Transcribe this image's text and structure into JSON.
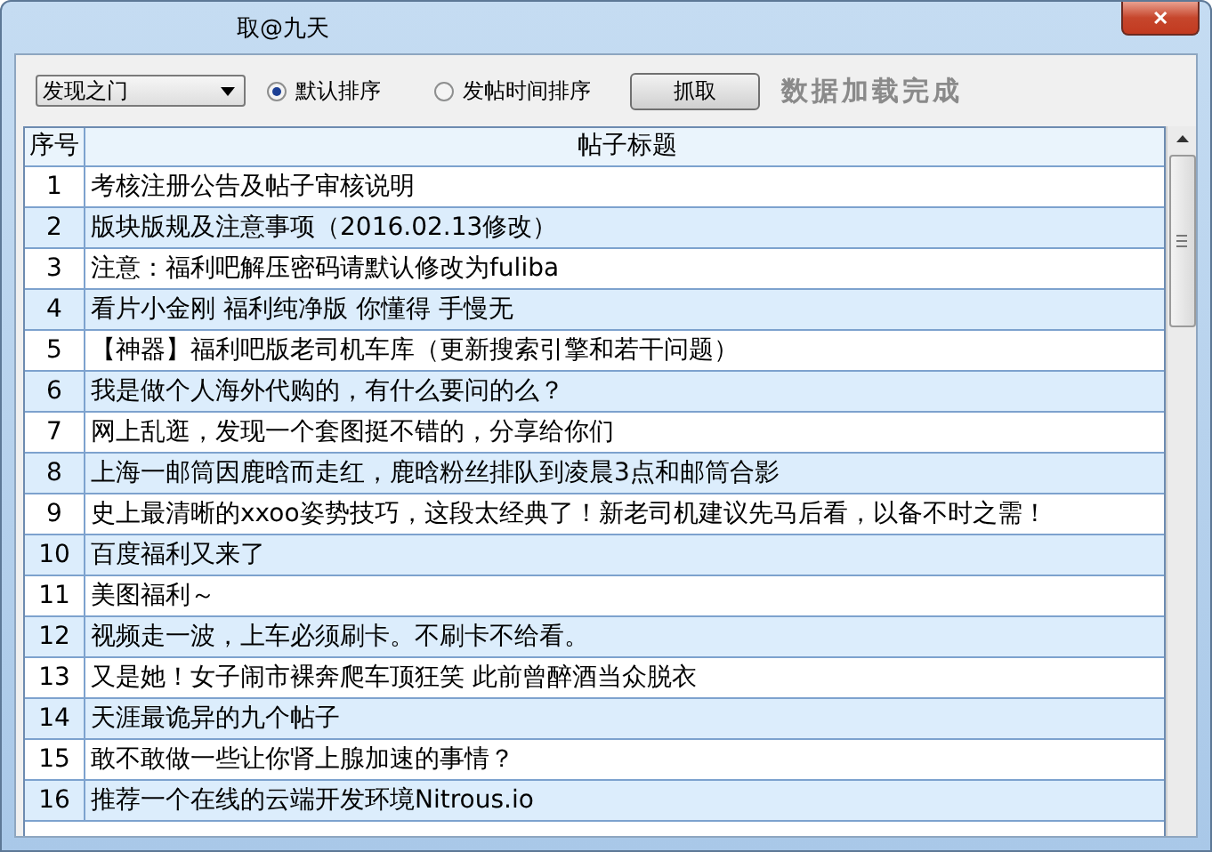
{
  "window": {
    "title": "取@九天",
    "close": "✕"
  },
  "toolbar": {
    "dropdown": {
      "value": "发现之门"
    },
    "radios": [
      {
        "label": "默认排序",
        "selected": true
      },
      {
        "label": "发帖时间排序",
        "selected": false
      }
    ],
    "button": "抓取",
    "status": "数据加载完成"
  },
  "table": {
    "columns": [
      "序号",
      "帖子标题"
    ],
    "rows": [
      {
        "index": "1",
        "title": "考核注册公告及帖子审核说明"
      },
      {
        "index": "2",
        "title": "版块版规及注意事项（2016.02.13修改）"
      },
      {
        "index": "3",
        "title": "注意：福利吧解压密码请默认修改为fuliba"
      },
      {
        "index": "4",
        "title": "看片小金刚 福利纯净版 你懂得 手慢无"
      },
      {
        "index": "5",
        "title": "【神器】福利吧版老司机车库（更新搜索引擎和若干问题）"
      },
      {
        "index": "6",
        "title": "我是做个人海外代购的，有什么要问的么？"
      },
      {
        "index": "7",
        "title": "网上乱逛，发现一个套图挺不错的，分享给你们"
      },
      {
        "index": "8",
        "title": "上海一邮筒因鹿晗而走红，鹿晗粉丝排队到凌晨3点和邮筒合影"
      },
      {
        "index": "9",
        "title": "史上最清晰的xxoo姿势技巧，这段太经典了！新老司机建议先马后看，以备不时之需！"
      },
      {
        "index": "10",
        "title": "百度福利又来了"
      },
      {
        "index": "11",
        "title": "美图福利～"
      },
      {
        "index": "12",
        "title": "视频走一波，上车必须刷卡。不刷卡不给看。"
      },
      {
        "index": "13",
        "title": "又是她！女子闹市裸奔爬车顶狂笑 此前曾醉酒当众脱衣"
      },
      {
        "index": "14",
        "title": "天涯最诡异的九个帖子"
      },
      {
        "index": "15",
        "title": "敢不敢做一些让你肾上腺加速的事情？"
      },
      {
        "index": "16",
        "title": "推荐一个在线的云端开发环境Nitrous.io"
      }
    ]
  }
}
